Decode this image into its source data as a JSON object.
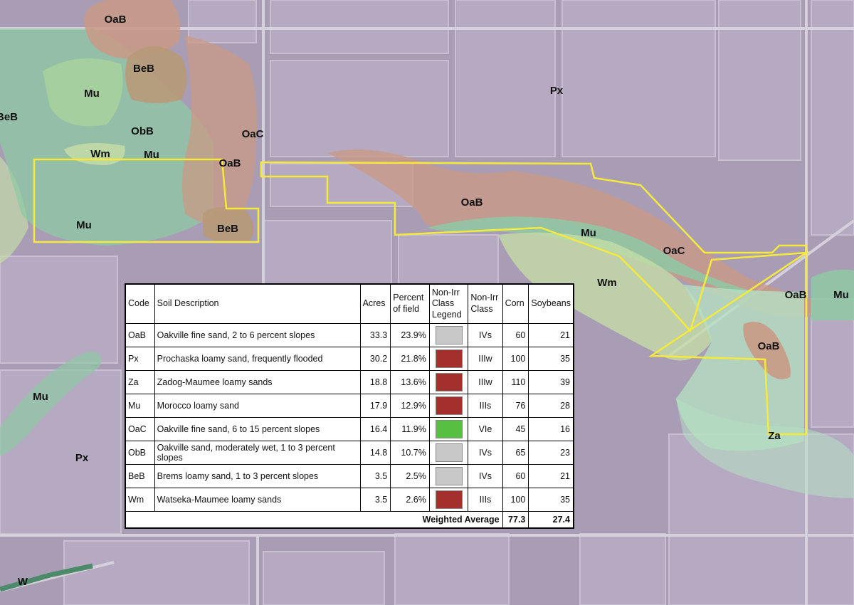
{
  "map": {
    "soil_labels": [
      {
        "code": "OaB"
      },
      {
        "code": "BeB"
      },
      {
        "code": "Mu"
      },
      {
        "code": "BeB"
      },
      {
        "code": "ObB"
      },
      {
        "code": "Wm"
      },
      {
        "code": "Mu"
      },
      {
        "code": "OaC"
      },
      {
        "code": "OaB"
      },
      {
        "code": "Mu"
      },
      {
        "code": "BeB"
      },
      {
        "code": "Px"
      },
      {
        "code": "OaB"
      },
      {
        "code": "Mu"
      },
      {
        "code": "OaC"
      },
      {
        "code": "Wm"
      },
      {
        "code": "OaB"
      },
      {
        "code": "Mu"
      },
      {
        "code": "OaB"
      },
      {
        "code": "Za"
      },
      {
        "code": "Mu"
      },
      {
        "code": "Px"
      },
      {
        "code": "W"
      }
    ],
    "colors": {
      "background": "#a99cb5",
      "oakville_zone": "#c99a86",
      "morocco_zone": "#8fc9a4",
      "watseka_zone": "#c4dca6",
      "zadog_zone": "#b4e0c2",
      "brems_zone": "#b79a78",
      "field_boundary": "#f5ea3c"
    }
  },
  "table": {
    "headers": {
      "code": "Code",
      "desc": "Soil Description",
      "acres": "Acres",
      "pct1": "Percent",
      "pct2": "of field",
      "legend1": "Non-Irr",
      "legend2": "Class",
      "legend3": "Legend",
      "class1": "Non-Irr",
      "class2": "Class",
      "corn": "Corn",
      "soy": "Soybeans"
    },
    "rows": [
      {
        "code": "OaB",
        "desc": "Oakville fine sand, 2 to 6 percent slopes",
        "acres": "33.3",
        "pct": "23.9%",
        "legend_color": "#c8c8c8",
        "cls": "IVs",
        "corn": "60",
        "soy": "21"
      },
      {
        "code": "Px",
        "desc": "Prochaska loamy sand, frequently flooded",
        "acres": "30.2",
        "pct": "21.8%",
        "legend_color": "#a3302c",
        "cls": "IIIw",
        "corn": "100",
        "soy": "35"
      },
      {
        "code": "Za",
        "desc": "Zadog-Maumee loamy sands",
        "acres": "18.8",
        "pct": "13.6%",
        "legend_color": "#a3302c",
        "cls": "IIIw",
        "corn": "110",
        "soy": "39"
      },
      {
        "code": "Mu",
        "desc": "Morocco loamy sand",
        "acres": "17.9",
        "pct": "12.9%",
        "legend_color": "#a3302c",
        "cls": "IIIs",
        "corn": "76",
        "soy": "28"
      },
      {
        "code": "OaC",
        "desc": "Oakville fine sand, 6 to 15 percent slopes",
        "acres": "16.4",
        "pct": "11.9%",
        "legend_color": "#57c043",
        "cls": "VIe",
        "corn": "45",
        "soy": "16"
      },
      {
        "code": "ObB",
        "desc": "Oakville sand, moderately wet, 1 to 3 percent slopes",
        "acres": "14.8",
        "pct": "10.7%",
        "legend_color": "#c8c8c8",
        "cls": "IVs",
        "corn": "65",
        "soy": "23"
      },
      {
        "code": "BeB",
        "desc": "Brems loamy sand, 1 to 3 percent slopes",
        "acres": "3.5",
        "pct": "2.5%",
        "legend_color": "#c8c8c8",
        "cls": "IVs",
        "corn": "60",
        "soy": "21"
      },
      {
        "code": "Wm",
        "desc": "Watseka-Maumee loamy sands",
        "acres": "3.5",
        "pct": "2.6%",
        "legend_color": "#a3302c",
        "cls": "IIIs",
        "corn": "100",
        "soy": "35"
      }
    ],
    "footer": {
      "label": "Weighted Average",
      "corn": "77.3",
      "soy": "27.4"
    }
  }
}
